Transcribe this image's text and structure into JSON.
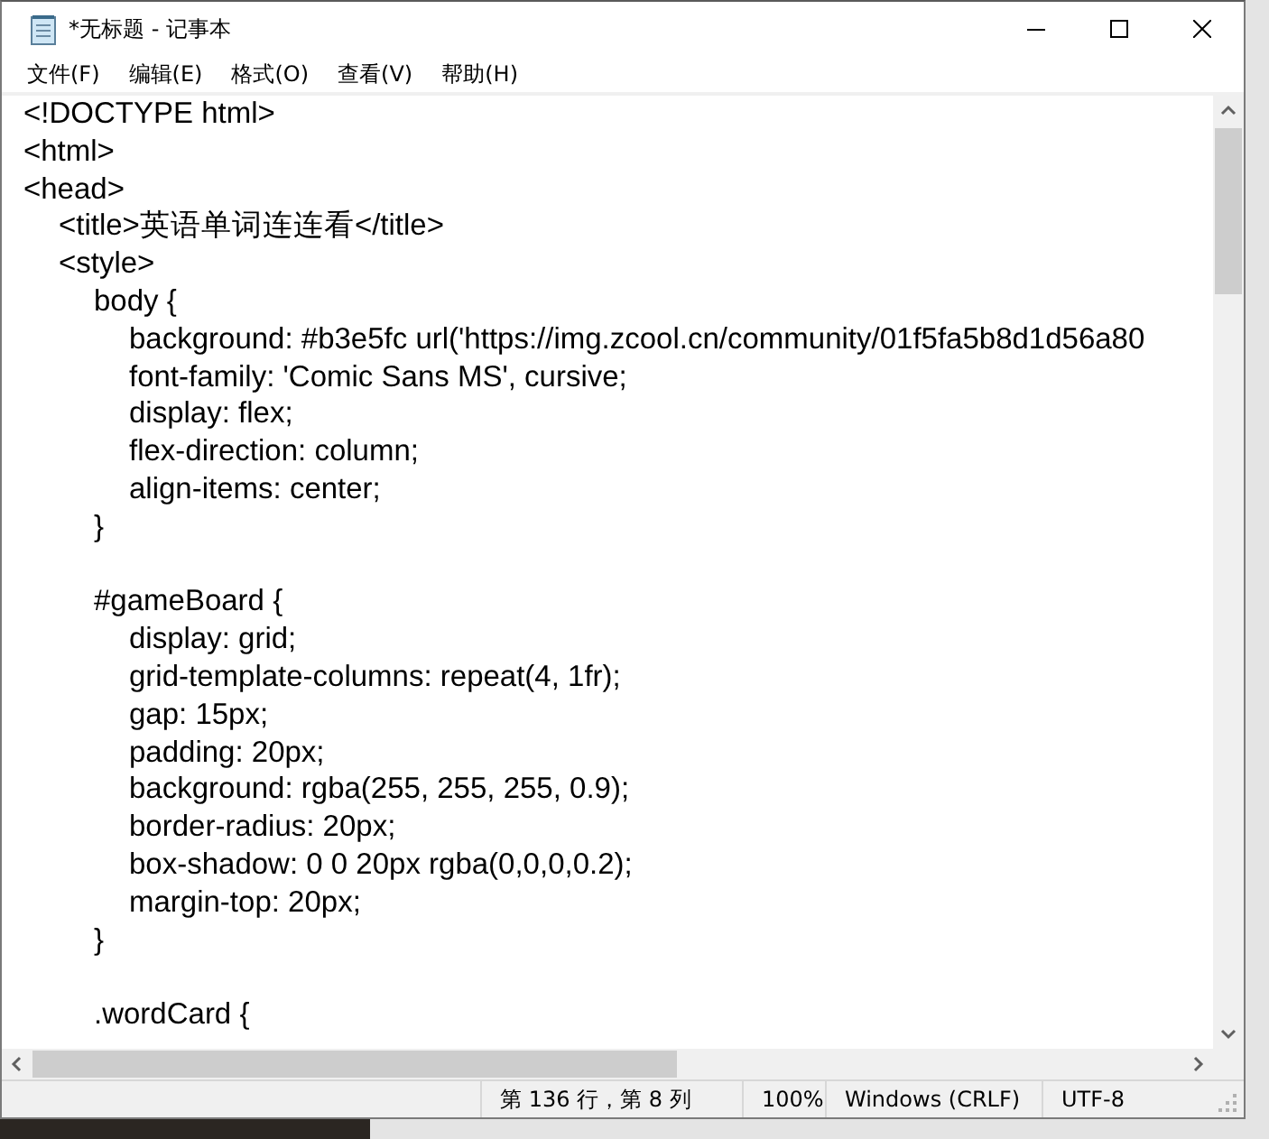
{
  "window": {
    "title": "*无标题 - 记事本"
  },
  "menu": [
    {
      "label": "文件(F)"
    },
    {
      "label": "编辑(E)"
    },
    {
      "label": "格式(O)"
    },
    {
      "label": "查看(V)"
    },
    {
      "label": "帮助(H)"
    }
  ],
  "editor": {
    "lines": [
      {
        "kind": "code",
        "text": "<!DOCTYPE html>"
      },
      {
        "kind": "code",
        "text": "<html>"
      },
      {
        "kind": "code",
        "text": "<head>"
      },
      {
        "kind": "code",
        "text": "\t<title>英语单词连连看</title>"
      },
      {
        "kind": "code",
        "text": "\t<style>"
      },
      {
        "kind": "code",
        "text": "\t\tbody {"
      },
      {
        "kind": "code",
        "text": "\t\t\tbackground: #b3e5fc url('https://img.zcool.cn/community/01f5fa5b8d1d56a80"
      },
      {
        "kind": "code",
        "text": "\t\t\tfont-family: 'Comic Sans MS', cursive;"
      },
      {
        "kind": "code",
        "text": "\t\t\tdisplay: flex;"
      },
      {
        "kind": "code",
        "text": "\t\t\tflex-direction: column;"
      },
      {
        "kind": "code",
        "text": "\t\t\talign-items: center;"
      },
      {
        "kind": "code",
        "text": "\t\t}"
      },
      {
        "kind": "blank"
      },
      {
        "kind": "code",
        "text": "\t\t#gameBoard {"
      },
      {
        "kind": "code",
        "text": "\t\t\tdisplay: grid;"
      },
      {
        "kind": "code",
        "text": "\t\t\tgrid-template-columns: repeat(4, 1fr);"
      },
      {
        "kind": "code",
        "text": "\t\t\tgap: 15px;"
      },
      {
        "kind": "code",
        "text": "\t\t\tpadding: 20px;"
      },
      {
        "kind": "code",
        "text": "\t\t\tbackground: rgba(255, 255, 255, 0.9);"
      },
      {
        "kind": "code",
        "text": "\t\t\tborder-radius: 20px;"
      },
      {
        "kind": "code",
        "text": "\t\t\tbox-shadow: 0 0 20px rgba(0,0,0,0.2);"
      },
      {
        "kind": "code",
        "text": "\t\t\tmargin-top: 20px;"
      },
      {
        "kind": "code",
        "text": "\t\t}"
      },
      {
        "kind": "blank"
      },
      {
        "kind": "code",
        "text": "\t\t.wordCard {"
      }
    ]
  },
  "status_bar": {
    "position": "第 136 行，第 8 列",
    "zoom": "100%",
    "line_ending": "Windows (CRLF)",
    "encoding": "UTF-8"
  }
}
